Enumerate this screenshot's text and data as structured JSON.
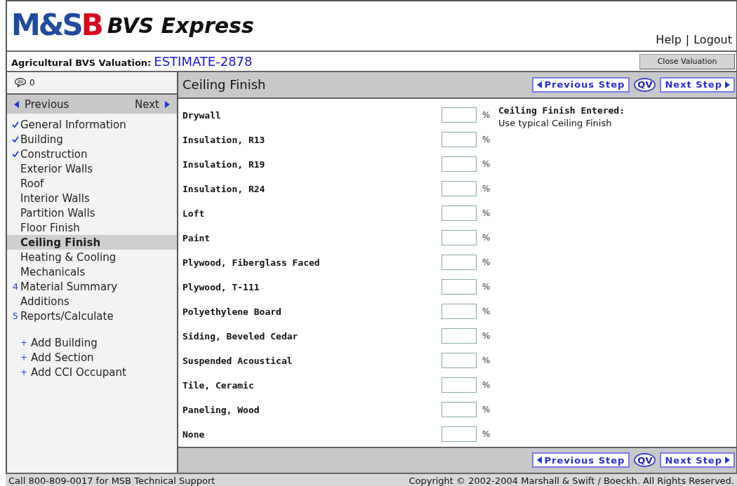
{
  "header": {
    "logo": {
      "left": "M&S",
      "right": "B"
    },
    "product": "BVS Express",
    "links": [
      "Help",
      "Logout"
    ],
    "link_separator": "|"
  },
  "valuation_bar": {
    "label": "Agricultural BVS Valuation:",
    "estimate": "ESTIMATE-2878",
    "close_button": "Close Valuation"
  },
  "sidebar": {
    "comments_count": "0",
    "previous": "Previous",
    "next": "Next",
    "items": [
      {
        "label": "General Information",
        "kind": "done",
        "selected": false
      },
      {
        "label": "Building",
        "kind": "done",
        "selected": false
      },
      {
        "label": "Construction",
        "kind": "done",
        "selected": false
      },
      {
        "label": "Exterior Walls",
        "kind": "plain",
        "selected": false
      },
      {
        "label": "Roof",
        "kind": "plain",
        "selected": false
      },
      {
        "label": "Interior Walls",
        "kind": "plain",
        "selected": false
      },
      {
        "label": "Partition Walls",
        "kind": "plain",
        "selected": false
      },
      {
        "label": "Floor Finish",
        "kind": "plain",
        "selected": false
      },
      {
        "label": "Ceiling Finish",
        "kind": "plain",
        "selected": true
      },
      {
        "label": "Heating & Cooling",
        "kind": "plain",
        "selected": false
      },
      {
        "label": "Mechanicals",
        "kind": "plain",
        "selected": false
      },
      {
        "label": "Material Summary",
        "kind": "numbered",
        "number": "4",
        "selected": false
      },
      {
        "label": "Additions",
        "kind": "plain",
        "selected": false
      },
      {
        "label": "Reports/Calculate",
        "kind": "numbered",
        "number": "5",
        "selected": false
      }
    ],
    "add_links": [
      {
        "icon": "+",
        "label": "Add Building"
      },
      {
        "icon": "+",
        "label": "Add Section"
      },
      {
        "icon": "+",
        "label": "Add CCI Occupant"
      }
    ]
  },
  "main": {
    "title": "Ceiling Finish",
    "top_steps": {
      "previous_step": "Previous Step",
      "qv": "QV",
      "next_step": "Next Step"
    },
    "bottom_steps": {
      "previous_step": "Previous Step",
      "qv": "QV",
      "next_step": "Next Step"
    },
    "rows": [
      {
        "label": "Drywall",
        "unit": "%"
      },
      {
        "label": "Insulation, R13",
        "unit": "%"
      },
      {
        "label": "Insulation, R19",
        "unit": "%"
      },
      {
        "label": "Insulation, R24",
        "unit": "%"
      },
      {
        "label": "Loft",
        "unit": "%"
      },
      {
        "label": "Paint",
        "unit": "%"
      },
      {
        "label": "Plywood, Fiberglass Faced",
        "unit": "%"
      },
      {
        "label": "Plywood, T-111",
        "unit": "%"
      },
      {
        "label": "Polyethylene Board",
        "unit": "%"
      },
      {
        "label": "Siding, Beveled Cedar",
        "unit": "%"
      },
      {
        "label": "Suspended Acoustical",
        "unit": "%"
      },
      {
        "label": "Tile, Ceramic",
        "unit": "%"
      },
      {
        "label": "Paneling, Wood",
        "unit": "%"
      },
      {
        "label": "None",
        "unit": "%"
      }
    ],
    "entered_title": "Ceiling Finish Entered:",
    "entered_text": "Use typical Ceiling Finish"
  },
  "status_bar": {
    "support": "Call 800-809-0017 for MSB Technical Support",
    "copyright": "Copyright © 2002-2004 Marshall & Swift / Boeckh. All Rights Reserved."
  }
}
